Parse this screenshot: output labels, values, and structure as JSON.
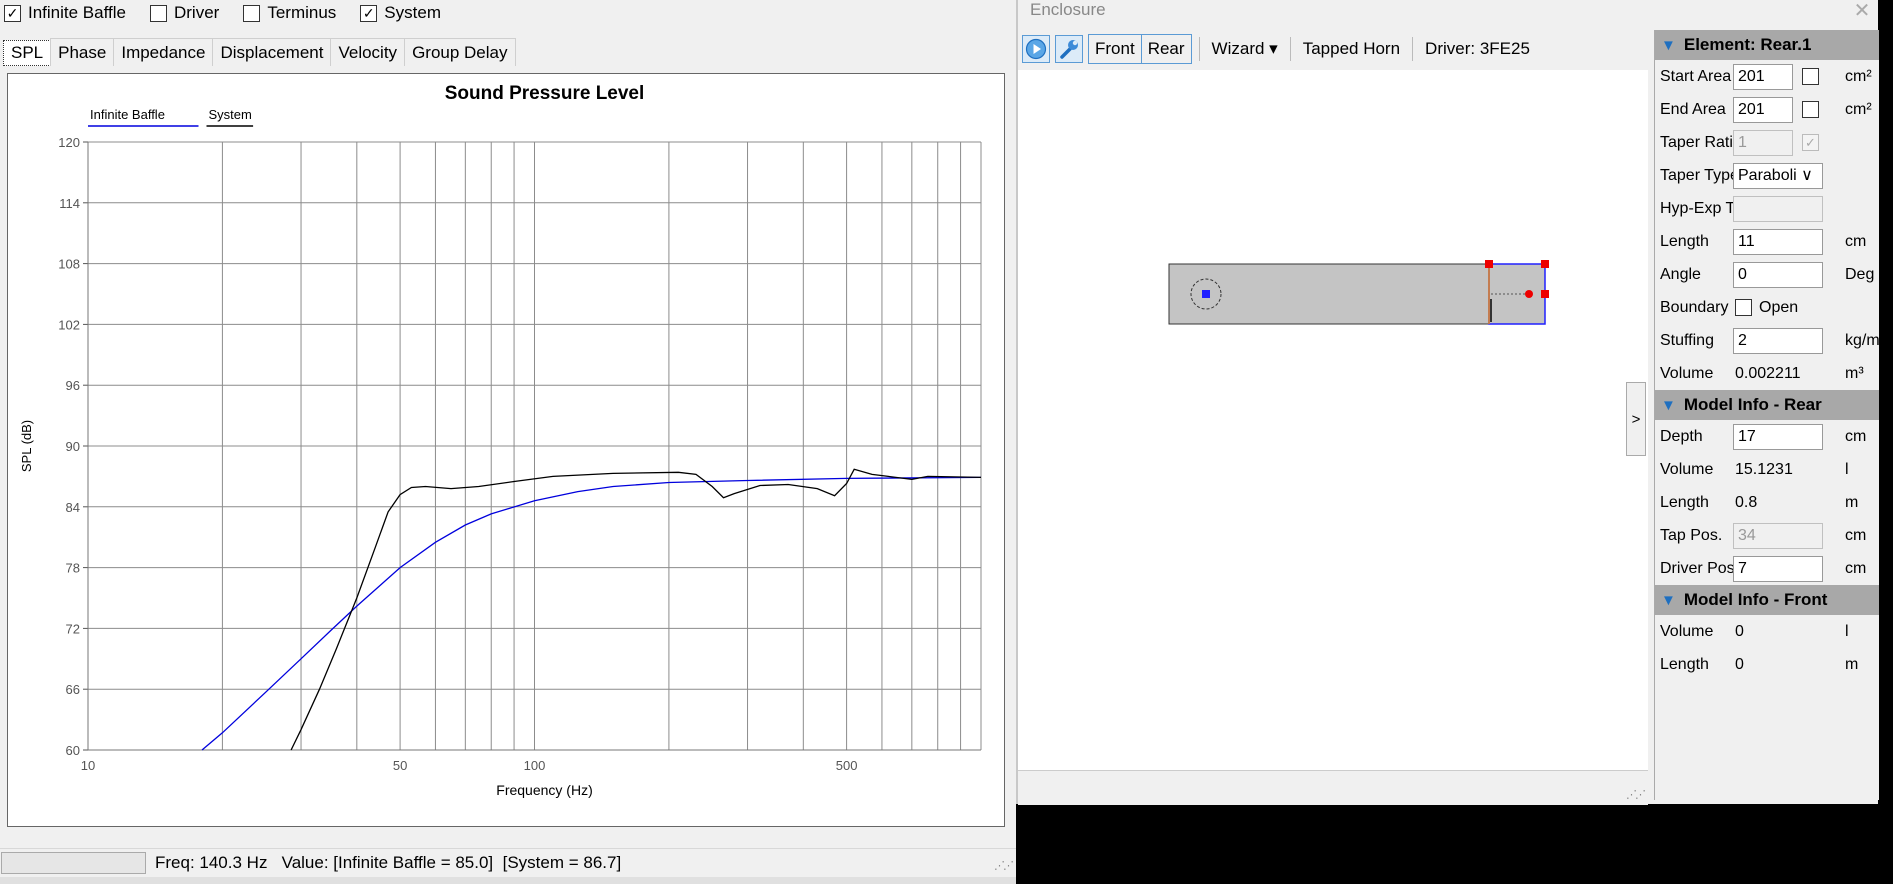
{
  "left_window": {
    "checkboxes": [
      {
        "label": "Infinite Baffle",
        "checked": true
      },
      {
        "label": "Driver",
        "checked": false
      },
      {
        "label": "Terminus",
        "checked": false
      },
      {
        "label": "System",
        "checked": true
      }
    ],
    "tabs": [
      "SPL",
      "Phase",
      "Impedance",
      "Displacement",
      "Velocity",
      "Group Delay"
    ],
    "status": {
      "text": "Freq: 140.3 Hz   Value: [Infinite Baffle = 85.0]  [System = 86.7]"
    }
  },
  "chart_data": {
    "type": "line",
    "title": "Sound Pressure Level",
    "xlabel": "Frequency (Hz)",
    "ylabel": "SPL (dB)",
    "xscale": "log",
    "xlim": [
      10,
      1000
    ],
    "ylim": [
      60,
      120
    ],
    "x_ticks": [
      10,
      50,
      100,
      500
    ],
    "y_ticks": [
      60,
      66,
      72,
      78,
      84,
      90,
      96,
      102,
      108,
      114,
      120
    ],
    "legend": [
      "Infinite Baffle",
      "System"
    ],
    "legend_position": "top-left",
    "grid": true,
    "series": [
      {
        "name": "Infinite Baffle",
        "color": "#0000dd",
        "points": [
          [
            18,
            60
          ],
          [
            20,
            61.7
          ],
          [
            25,
            65.7
          ],
          [
            30,
            69
          ],
          [
            35,
            71.8
          ],
          [
            40,
            74.2
          ],
          [
            50,
            78.0
          ],
          [
            60,
            80.5
          ],
          [
            70,
            82.2
          ],
          [
            80,
            83.3
          ],
          [
            100,
            84.6
          ],
          [
            125,
            85.5
          ],
          [
            150,
            86.0
          ],
          [
            200,
            86.4
          ],
          [
            300,
            86.6
          ],
          [
            500,
            86.8
          ],
          [
            1000,
            86.9
          ]
        ]
      },
      {
        "name": "System",
        "color": "#000000",
        "points": [
          [
            28.5,
            60
          ],
          [
            30,
            62
          ],
          [
            33,
            66
          ],
          [
            36,
            70
          ],
          [
            40,
            75
          ],
          [
            44,
            80
          ],
          [
            47,
            83.5
          ],
          [
            50,
            85.2
          ],
          [
            53,
            85.9
          ],
          [
            57,
            86
          ],
          [
            65,
            85.8
          ],
          [
            75,
            86
          ],
          [
            90,
            86.5
          ],
          [
            110,
            87
          ],
          [
            150,
            87.3
          ],
          [
            210,
            87.4
          ],
          [
            230,
            87.2
          ],
          [
            250,
            86.0
          ],
          [
            265,
            84.9
          ],
          [
            280,
            85.3
          ],
          [
            320,
            86.1
          ],
          [
            370,
            86.2
          ],
          [
            430,
            85.8
          ],
          [
            470,
            85.1
          ],
          [
            500,
            86.3
          ],
          [
            520,
            87.7
          ],
          [
            570,
            87.2
          ],
          [
            620,
            87.0
          ],
          [
            700,
            86.7
          ],
          [
            760,
            87.0
          ],
          [
            1000,
            86.9
          ]
        ]
      }
    ]
  },
  "enclosure": {
    "title": "Enclosure",
    "close": "✕",
    "toolbar": {
      "front": "Front",
      "rear": "Rear",
      "wizard": "Wizard ▾",
      "tapped": "Tapped Horn",
      "driver": "Driver: 3FE25"
    },
    "element_header": "Element: Rear.1",
    "element": {
      "start_area_label": "Start Area",
      "start_area": "201",
      "cm2": "cm²",
      "end_area_label": "End Area",
      "end_area": "201",
      "taper_ratio_label": "Taper Ratio",
      "taper_ratio": "1",
      "taper_ratio_check": "✓",
      "taper_type_label": "Taper Type",
      "taper_type": "Paraboli ∨",
      "hypexp_label": "Hyp-Exp T",
      "length_label": "Length",
      "length": "11",
      "cm": "cm",
      "angle_label": "Angle",
      "angle": "0",
      "deg": "Deg",
      "boundary_label": "Boundary",
      "boundary_open": "Open",
      "stuffing_label": "Stuffing",
      "stuffing": "2",
      "kgm": "kg/m",
      "volume_label": "Volume",
      "volume": "0.002211",
      "m3": "m³"
    },
    "model_rear_header": "Model Info - Rear",
    "model_rear": {
      "depth_label": "Depth",
      "depth": "17",
      "cm": "cm",
      "volume_label": "Volume",
      "volume": "15.1231",
      "l": "l",
      "length_label": "Length",
      "length": "0.8",
      "m": "m",
      "tap_label": "Tap Pos.",
      "tap": "34",
      "driver_label": "Driver Pos.",
      "driver": "7"
    },
    "model_front_header": "Model Info - Front",
    "model_front": {
      "volume_label": "Volume",
      "volume": "0",
      "l": "l",
      "length_label": "Length",
      "length": "0",
      "m": "m"
    },
    "expand": ">"
  }
}
